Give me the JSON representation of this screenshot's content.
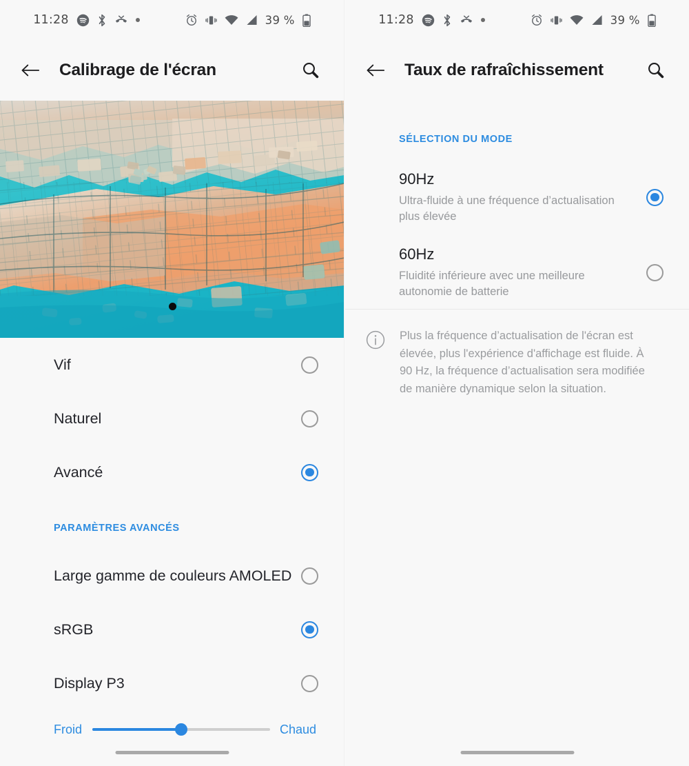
{
  "status_bar": {
    "time": "11:28",
    "battery_percent": "39 %",
    "icons_left": [
      "spotify-icon",
      "bluetooth-icon",
      "call-missed-icon",
      "dot-icon"
    ],
    "icons_right": [
      "alarm-icon",
      "vibrate-icon",
      "wifi-icon",
      "signal-icon",
      "battery-icon"
    ]
  },
  "left_screen": {
    "appbar": {
      "back_icon": "arrow-back-icon",
      "title": "Calibrage de l'écran",
      "search_icon": "search-icon"
    },
    "preview": {
      "alt": "Aerial photo of submerged stone ruins in turquoise water",
      "camera_cutout": true
    },
    "modes": [
      {
        "label": "Vif",
        "selected": false
      },
      {
        "label": "Naturel",
        "selected": false
      },
      {
        "label": "Avancé",
        "selected": true
      }
    ],
    "advanced_section": {
      "header": "PARAMÈTRES AVANCÉS",
      "options": [
        {
          "label": "Large gamme de couleurs AMOLED",
          "selected": false
        },
        {
          "label": "sRGB",
          "selected": true
        },
        {
          "label": "Display P3",
          "selected": false
        }
      ]
    },
    "temperature_slider": {
      "left_label": "Froid",
      "right_label": "Chaud",
      "value_percent": 50
    }
  },
  "right_screen": {
    "appbar": {
      "back_icon": "arrow-back-icon",
      "title": "Taux de rafraîchissement",
      "search_icon": "search-icon"
    },
    "section_header": "SÉLECTION DU MODE",
    "modes": [
      {
        "title": "90Hz",
        "description": "Ultra-fluide à une fréquence d’actualisation plus élevée",
        "selected": true
      },
      {
        "title": "60Hz",
        "description": "Fluidité inférieure avec une meilleure autonomie de batterie",
        "selected": false
      }
    ],
    "note": {
      "icon": "info-icon",
      "text": "Plus la fréquence d’actualisation de l'écran est élevée, plus l'expérience d'affichage est fluide. À 90 Hz, la fréquence d’actualisation sera modifiée de manière dynamique selon la situation."
    }
  },
  "colors": {
    "accent": "#2b87e0",
    "section_header": "#2d8ce0",
    "background": "#f8f8f8",
    "text_primary": "#1f2024",
    "text_secondary": "#97999c"
  }
}
